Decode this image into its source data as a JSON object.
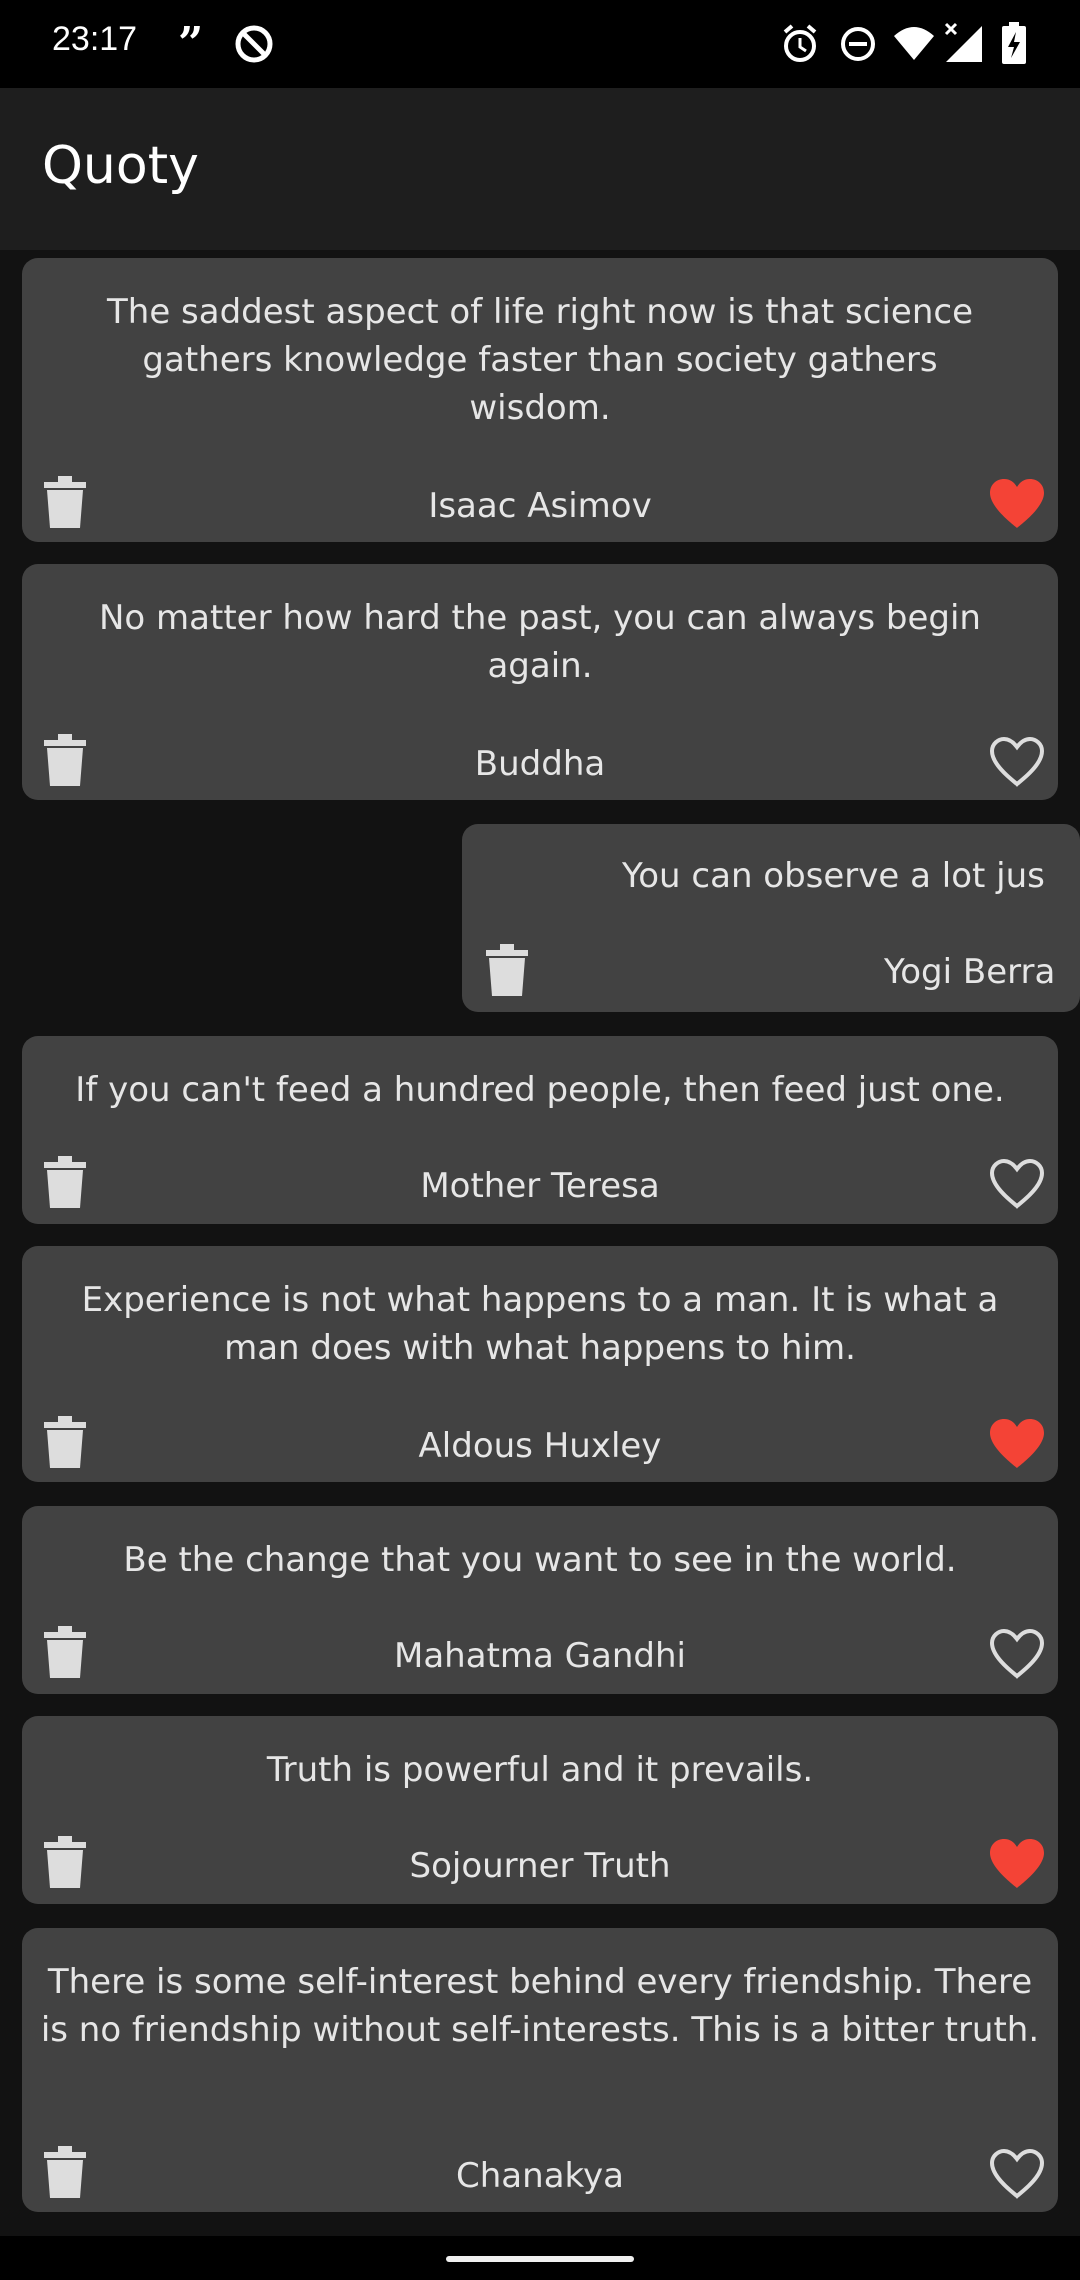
{
  "status_bar": {
    "time": "23:17",
    "left_icons": [
      "quote-notification-icon",
      "at-sign-notification-icon"
    ],
    "right_icons": [
      "alarm-icon",
      "do-not-disturb-icon",
      "wifi-icon",
      "signal-icon",
      "battery-charging-icon"
    ]
  },
  "app_bar": {
    "title": "Quoty"
  },
  "colors": {
    "background": "#121212",
    "app_bar": "#1e1e1e",
    "card": "#424242",
    "text": "#e6e6e6",
    "favorite": "#f44336"
  },
  "quotes": [
    {
      "text": "The saddest aspect of life right now is that science gathers knowledge faster than society gathers wisdom.",
      "author": "Isaac Asimov",
      "favorite": true
    },
    {
      "text": "No matter how hard the past, you can always begin again.",
      "author": "Buddha",
      "favorite": false
    },
    {
      "text": "You can observe a lot jus",
      "author": "Yogi Berra",
      "favorite": false
    },
    {
      "text": "If you can't feed a hundred people, then feed just one.",
      "author": "Mother Teresa",
      "favorite": false
    },
    {
      "text": "Experience is not what happens to a man. It is what a man does with what happens to him.",
      "author": "Aldous Huxley",
      "favorite": true
    },
    {
      "text": "Be the change that you want to see in the world.",
      "author": "Mahatma Gandhi",
      "favorite": false
    },
    {
      "text": "Truth is powerful and it prevails.",
      "author": "Sojourner Truth",
      "favorite": true
    },
    {
      "text": "There is some self-interest behind every friendship. There is no friendship without self-interests. This is a bitter truth.",
      "author": "Chanakya",
      "favorite": false
    }
  ]
}
